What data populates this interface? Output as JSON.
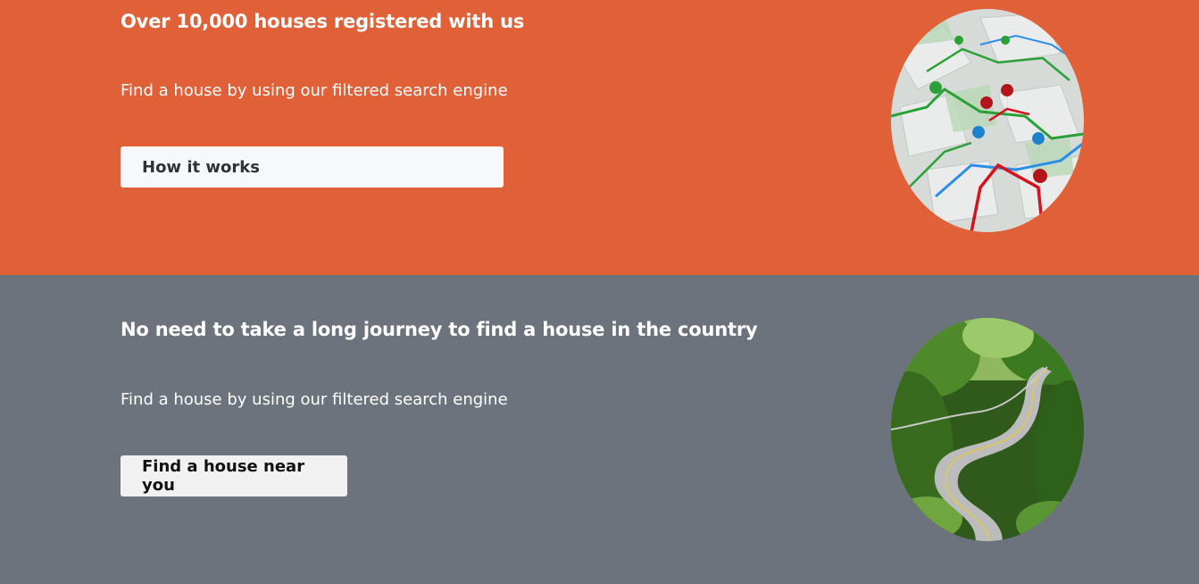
{
  "section_one": {
    "heading": "Over 10,000 houses registered with us",
    "subtext": "Find a house by using our filtered search engine",
    "button_label": "How it works",
    "background_color": "#e06038",
    "image_icon": "map-navigation-image"
  },
  "section_two": {
    "heading": "No need to take a long journey to find a house in the country",
    "subtext": "Find a house by using our filtered search engine",
    "button_label": "Find a house near you",
    "background_color": "#6c737c",
    "image_icon": "winding-road-image"
  }
}
